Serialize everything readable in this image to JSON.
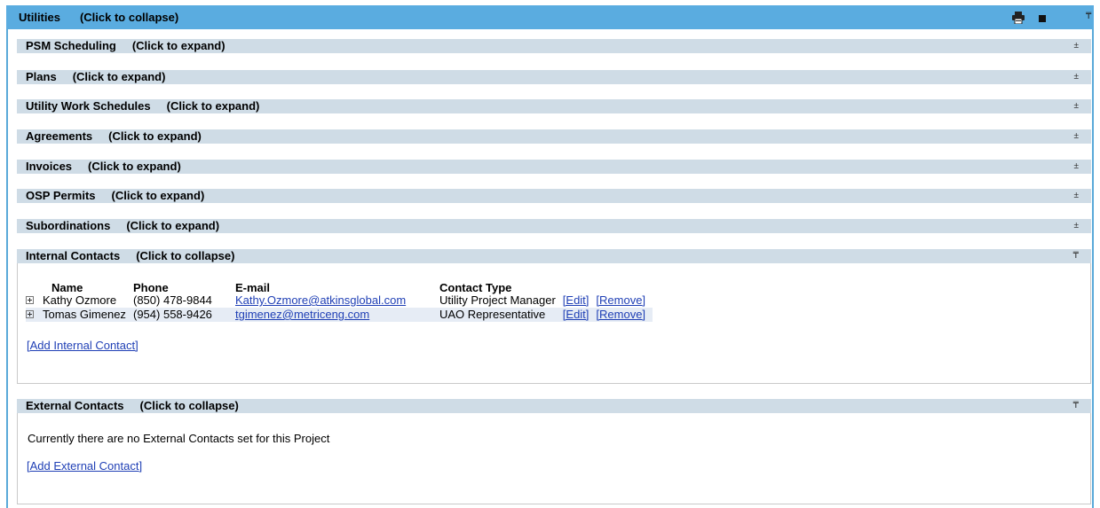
{
  "utilities": {
    "title": "Utilities",
    "hint": "(Click to collapse)",
    "print_icon": "printer-icon",
    "stop_icon": "square-icon",
    "collapse_icon": "collapse-all-icon"
  },
  "sections": [
    {
      "label": "PSM Scheduling",
      "hint": "(Click to expand)",
      "toggle": "±"
    },
    {
      "label": "Plans",
      "hint": "(Click to expand)",
      "toggle": "±"
    },
    {
      "label": "Utility Work Schedules",
      "hint": "(Click to expand)",
      "toggle": "±"
    },
    {
      "label": "Agreements",
      "hint": "(Click to expand)",
      "toggle": "±"
    },
    {
      "label": "Invoices",
      "hint": "(Click to expand)",
      "toggle": "±"
    },
    {
      "label": "OSP Permits",
      "hint": "(Click to expand)",
      "toggle": "±"
    },
    {
      "label": "Subordinations",
      "hint": "(Click to expand)",
      "toggle": "±"
    }
  ],
  "internal": {
    "label": "Internal Contacts",
    "hint": "(Click to collapse)",
    "toggle": "₸",
    "columns": {
      "name": "Name",
      "phone": "Phone",
      "email": "E-mail",
      "type": "Contact Type"
    },
    "rows": [
      {
        "name": "Kathy Ozmore",
        "phone": "(850) 478-9844",
        "email": "Kathy.Ozmore@atkinsglobal.com",
        "type": "Utility Project Manager",
        "edit": "[Edit]",
        "remove": "[Remove]"
      },
      {
        "name": "Tomas Gimenez",
        "phone": "(954) 558-9426",
        "email": "tgimenez@metriceng.com",
        "type": "UAO Representative",
        "edit": "[Edit]",
        "remove": "[Remove]"
      }
    ],
    "add_link": "[Add Internal Contact]"
  },
  "external": {
    "label": "External Contacts",
    "hint": "(Click to collapse)",
    "toggle": "₸",
    "empty_message": "Currently there are no External Contacts set for this Project",
    "add_link": "[Add External Contact]"
  }
}
